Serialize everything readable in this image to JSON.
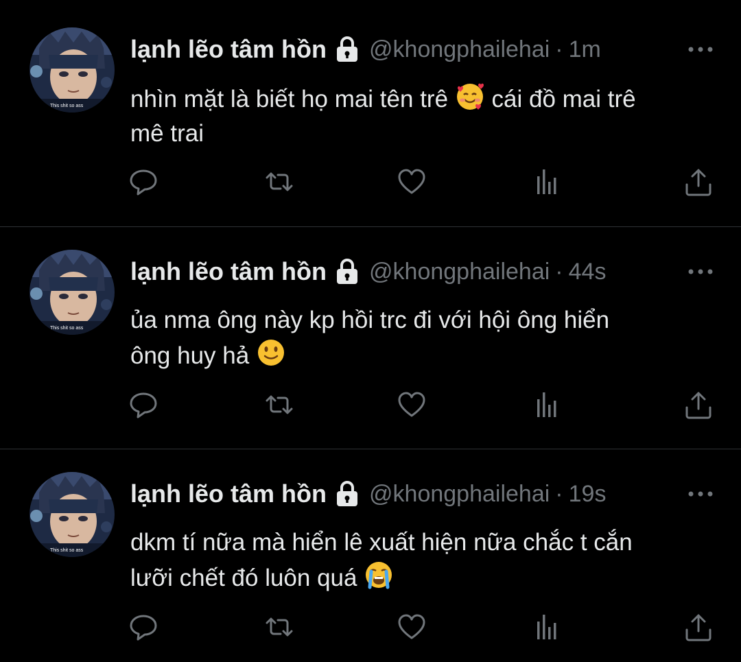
{
  "tweets": [
    {
      "display_name": "lạnh lẽo tâm hồn",
      "handle": "@khongphailehai",
      "separator": "·",
      "time": "1m",
      "text_line1": "nhìn mặt là biết họ mai tên trê",
      "emoji1": "smiling-face-with-hearts",
      "text_line1b": "cái đồ mai trê",
      "text_line2": "mê trai",
      "avatar_caption": "This shit so ass"
    },
    {
      "display_name": "lạnh lẽo tâm hồn",
      "handle": "@khongphailehai",
      "separator": "·",
      "time": "44s",
      "text_line1": "ủa nma ông này kp hồi trc đi với hội ông hiển",
      "text_line2": "ông huy hả",
      "emoji1": "slightly-smiling-face",
      "avatar_caption": "This shit so ass"
    },
    {
      "display_name": "lạnh lẽo tâm hồn",
      "handle": "@khongphailehai",
      "separator": "·",
      "time": "19s",
      "text_line1": "dkm tí nữa mà hiển lê xuất hiện nữa chắc t cắn",
      "text_line2": "lưỡi chết đó luôn quá",
      "emoji1": "loudly-crying-face",
      "avatar_caption": "This shit so ass"
    }
  ],
  "colors": {
    "background": "#000000",
    "text": "#e7e9ea",
    "muted": "#71767b",
    "divider": "#2f3336"
  }
}
